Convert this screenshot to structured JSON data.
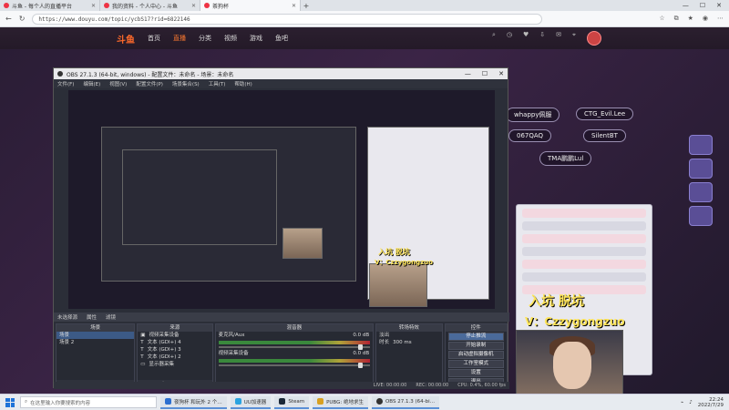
{
  "browser": {
    "tabs": [
      {
        "label": "斗鱼 - 每个人的直播平台",
        "active": false
      },
      {
        "label": "我的资料 - 个人中心 - 斗鱼",
        "active": false
      },
      {
        "label": "茶狗杯",
        "active": true
      }
    ],
    "url": "https://www.douyu.com/topic/ycbS17?rid=6822146"
  },
  "site": {
    "logo": "斗鱼",
    "nav": [
      "首页",
      "直播",
      "分类",
      "视频",
      "游戏",
      "鱼吧"
    ],
    "active_nav": "直播"
  },
  "stream": {
    "chips": [
      "whappy佩服",
      "CTG_Evil.Lee",
      "067QAQ",
      "SilentBT",
      "TMA鹏鹏Lul"
    ],
    "overlay_line1": "入坑 脱坑",
    "overlay_line2": "V：Czzygongzuo"
  },
  "obs": {
    "title": "OBS 27.1.3 (64-bit, windows) - 配置文件：未命名 - 场景：未命名",
    "menu": [
      "文件(F)",
      "编辑(E)",
      "视图(V)",
      "配置文件(P)",
      "场景集合(S)",
      "工具(T)",
      "帮助(H)"
    ],
    "scene_bar": [
      "未选择源",
      "属性",
      "滤镜"
    ],
    "docks": {
      "scenes": {
        "header": "场景",
        "items": [
          "场景",
          "场景 2"
        ]
      },
      "sources": {
        "header": "来源",
        "items": [
          "视频采集设备",
          "文本 (GDI+) 4",
          "文本 (GDI+) 3",
          "文本 (GDI+) 2",
          "显示器采集"
        ]
      },
      "mixer": {
        "header": "混音器",
        "channels": [
          {
            "name": "麦克风/Aux",
            "db": "0.0 dB"
          },
          {
            "name": "视频采集设备",
            "db": "0.0 dB"
          }
        ]
      },
      "transitions": {
        "header": "转场特效",
        "type": "淡出",
        "duration_label": "时长",
        "duration": "300 ms"
      },
      "controls": {
        "header": "控件",
        "buttons": [
          "停止推流",
          "开始录制",
          "启动虚拟摄像机",
          "工作室模式",
          "设置",
          "退出"
        ]
      }
    },
    "status": [
      "LIVE: 00:00:00",
      "REC: 00:00:00",
      "CPU: 0.4%, 60.00 fps"
    ]
  },
  "taskbar": {
    "search_placeholder": "在这里输入你要搜索的内容",
    "apps": [
      "夜狗杯 和玩外 2 个…",
      "UU加速器",
      "Steam",
      "PUBG: 绝地求生",
      "OBS 27.1.3 (64-bi…"
    ],
    "time": "22:24",
    "date": "2022/7/29"
  }
}
